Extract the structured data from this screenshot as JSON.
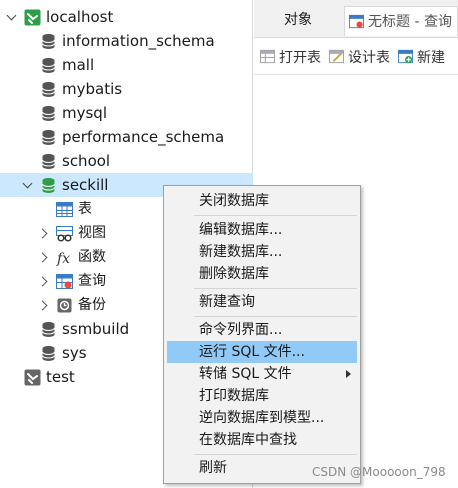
{
  "tree": {
    "connection": {
      "label": "localhost"
    },
    "databases": [
      {
        "label": "information_schema"
      },
      {
        "label": "mall"
      },
      {
        "label": "mybatis"
      },
      {
        "label": "mysql"
      },
      {
        "label": "performance_schema"
      },
      {
        "label": "school"
      },
      {
        "label": "seckill"
      },
      {
        "label": "ssmbuild"
      },
      {
        "label": "sys"
      }
    ],
    "seckill_children": [
      {
        "label": "表",
        "icon": "table-icon"
      },
      {
        "label": "视图",
        "icon": "view-icon"
      },
      {
        "label": "函数",
        "icon": "function-icon"
      },
      {
        "label": "查询",
        "icon": "query-icon"
      },
      {
        "label": "备份",
        "icon": "backup-icon"
      }
    ],
    "connection2": {
      "label": "test"
    }
  },
  "tabs": {
    "objects": "对象",
    "query": "无标题 - 查询"
  },
  "toolbar": {
    "open_table": "打开表",
    "design_table": "设计表",
    "new": "新建"
  },
  "context_menu": {
    "close_db": "关闭数据库",
    "edit_db": "编辑数据库...",
    "new_db": "新建数据库...",
    "delete_db": "删除数据库",
    "new_query": "新建查询",
    "console": "命令列界面...",
    "run_sql": "运行 SQL 文件...",
    "dump_sql": "转储 SQL 文件",
    "print_db": "打印数据库",
    "reverse_model": "逆向数据库到模型...",
    "find_in_db": "在数据库中查找",
    "refresh": "刷新"
  },
  "watermark": "CSDN @Mooooon_798",
  "colors": {
    "selected_row": "#cce8ff",
    "menu_highlight": "#91c9f7",
    "db_open_icon": "#2e9e4a",
    "db_icon": "#555555"
  }
}
